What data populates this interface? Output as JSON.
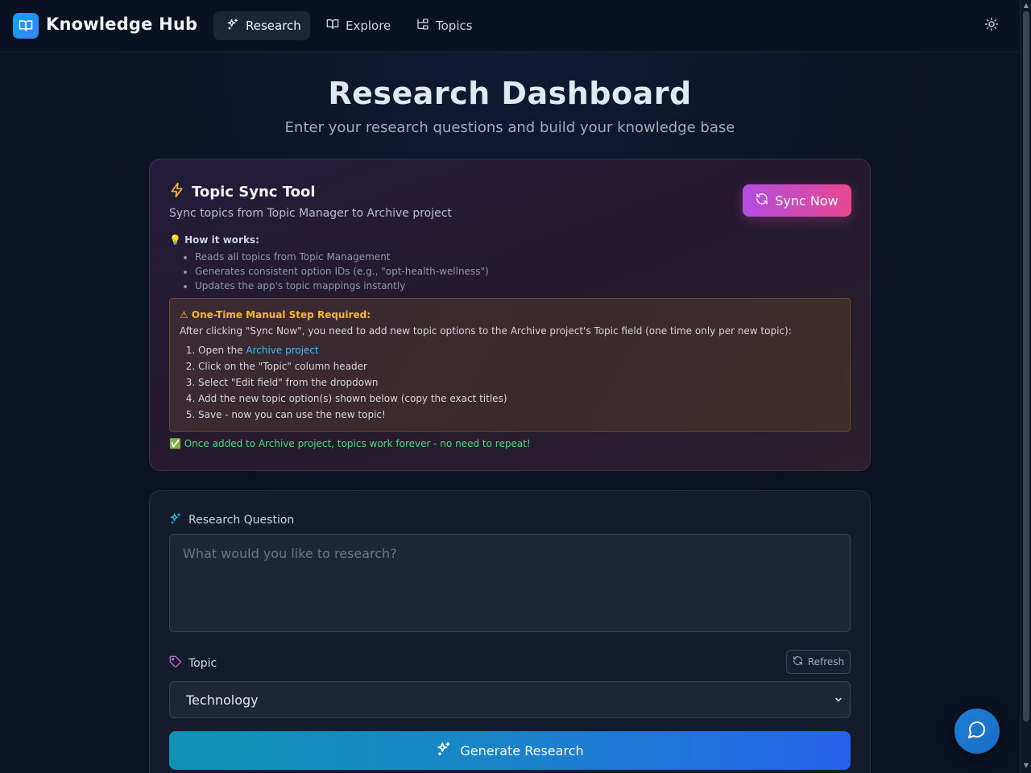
{
  "header": {
    "brand": "Knowledge Hub",
    "nav": [
      {
        "label": "Research",
        "icon": "sparkles-icon",
        "active": true
      },
      {
        "label": "Explore",
        "icon": "book-open-icon",
        "active": false
      },
      {
        "label": "Topics",
        "icon": "folder-tree-icon",
        "active": false
      }
    ],
    "theme_icon": "sun-icon"
  },
  "page": {
    "title": "Research Dashboard",
    "subtitle": "Enter your research questions and build your knowledge base"
  },
  "sync_tool": {
    "title": "Topic Sync Tool",
    "subtitle": "Sync topics from Topic Manager to Archive project",
    "button_label": "Sync Now",
    "how_title": "💡 How it works:",
    "how_items": [
      "Reads all topics from Topic Management",
      "Generates consistent option IDs (e.g., \"opt-health-wellness\")",
      "Updates the app's topic mappings instantly"
    ],
    "warning": {
      "title": "⚠ One-Time Manual Step Required:",
      "description": "After clicking \"Sync Now\", you need to add new topic options to the Archive project's Topic field (one time only per new topic):",
      "step1_prefix": "Open the ",
      "step1_link": "Archive project",
      "steps": [
        "Click on the \"Topic\" column header",
        "Select \"Edit field\" from the dropdown",
        "Add the new topic option(s) shown below (copy the exact titles)",
        "Save - now you can use the new topic!"
      ]
    },
    "ok_note": "✅ Once added to Archive project, topics work forever - no need to repeat!"
  },
  "research_form": {
    "question_label": "Research Question",
    "question_placeholder": "What would you like to research?",
    "question_value": "",
    "topic_label": "Topic",
    "refresh_label": "Refresh",
    "topic_selected": "Technology",
    "generate_label": "Generate Research"
  },
  "colors": {
    "accent_sync": "#e8478f",
    "accent_generate": "#2563eb",
    "warning": "#f5b82e",
    "success": "#4ade80",
    "link": "#38bdf8"
  }
}
